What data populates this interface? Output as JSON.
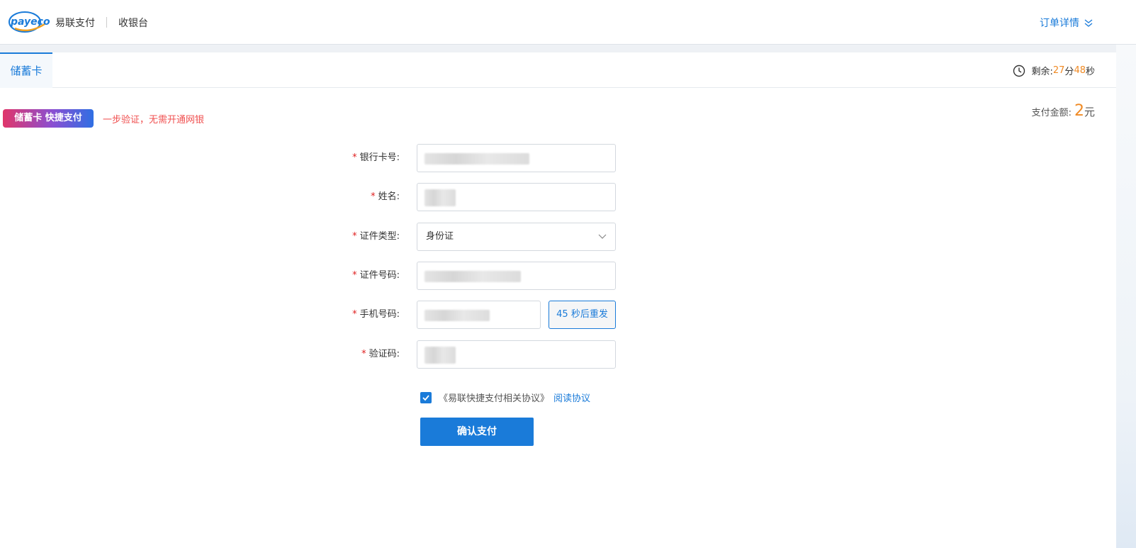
{
  "header": {
    "logo_text": "payeco",
    "brand_name": "易联支付",
    "cashier_label": "收银台",
    "order_detail_label": "订单详情"
  },
  "tabs": [
    {
      "label": "储蓄卡",
      "active": true
    }
  ],
  "timer": {
    "prefix": "剩余:",
    "minutes": "27",
    "min_unit": "分",
    "seconds": "48",
    "sec_unit": "秒"
  },
  "promo": {
    "badge": "储蓄卡 快捷支付",
    "slogan": "一步验证，无需开通网银"
  },
  "amount": {
    "label": "支付金额:",
    "value": "2",
    "unit": "元"
  },
  "form": {
    "required_mark": "*",
    "card_number_label": "银行卡号:",
    "name_label": "姓名:",
    "id_type_label": "证件类型:",
    "id_type_value": "身份证",
    "id_number_label": "证件号码:",
    "phone_label": "手机号码:",
    "resend_label": "45 秒后重发",
    "code_label": "验证码:"
  },
  "agreement": {
    "text": "《易联快捷支付相关协议》",
    "link": "阅读协议",
    "checked": true
  },
  "submit_label": "确认支付",
  "colors": {
    "primary": "#1a7bd9",
    "accent": "#f08a24",
    "alert": "#f05050"
  }
}
